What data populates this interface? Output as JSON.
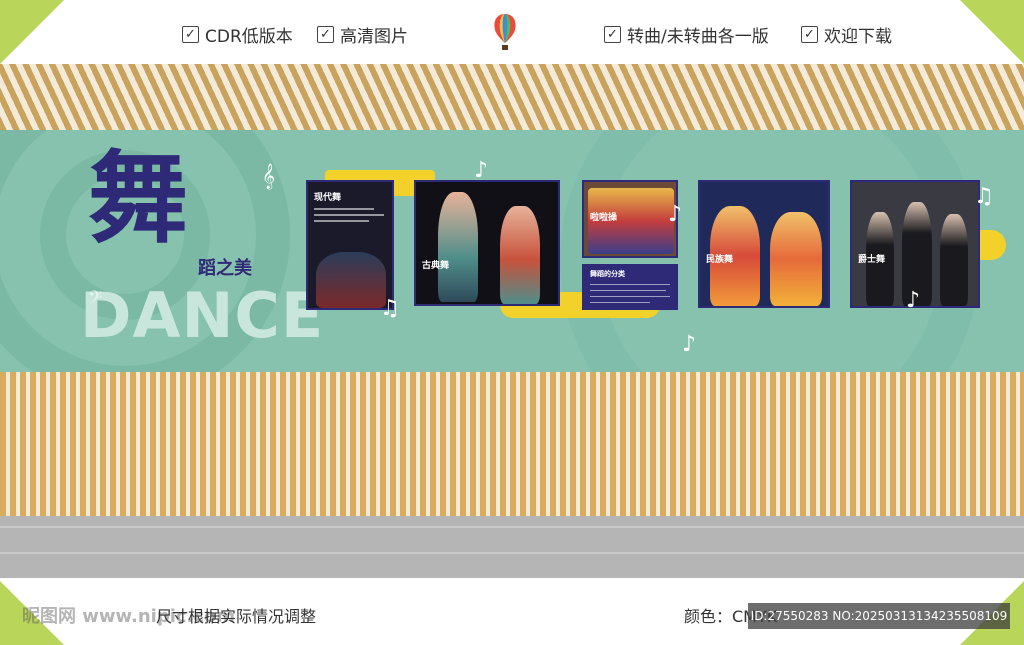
{
  "header": {
    "features": [
      {
        "label": "CDR低版本"
      },
      {
        "label": "高清图片"
      },
      {
        "label": "转曲/未转曲各一版"
      },
      {
        "label": "欢迎下载"
      }
    ],
    "app_icon": "coreldraw-balloon-icon"
  },
  "logo": {
    "main_char": "舞",
    "subtitle": "蹈之美",
    "latin": "DANCE"
  },
  "panels": [
    {
      "label": "现代舞"
    },
    {
      "label": "古典舞"
    },
    {
      "label": "啦啦操"
    },
    {
      "label": "舞蹈的分类"
    },
    {
      "label": "民族舞"
    },
    {
      "label": "爵士舞"
    }
  ],
  "footer": {
    "note": "尺寸根据实际情况调整",
    "color_mode": "颜色：CMYK",
    "watermark": "昵图网 www.nipic.com",
    "id_text": "ID:27550283 NO:20250313134235508109"
  },
  "colors": {
    "accent_green": "#b9d55a",
    "teal": "#86c2ae",
    "navy": "#2f2a77",
    "gold_stripe": "#d8ab5e",
    "yellow": "#f2d22a"
  }
}
